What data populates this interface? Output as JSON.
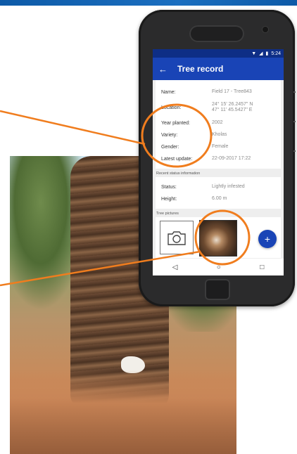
{
  "icons": {
    "back": "arrow-left-icon",
    "camera": "camera-icon",
    "add": "plus-icon",
    "nav_back": "triangle-back-icon",
    "nav_home": "circle-home-icon",
    "nav_recent": "square-recent-icon",
    "wifi": "wifi-icon",
    "signal": "signal-icon",
    "battery": "battery-icon"
  },
  "status_bar": {
    "time": "5:24"
  },
  "app_bar": {
    "title": "Tree record"
  },
  "record": {
    "name_label": "Name:",
    "name_value": "Field 17 - Tree843",
    "location_label": "Location:",
    "location_lat": "24° 15' 26.2457\" N",
    "location_lon": "47° 11' 45.5427\" E",
    "year_label": "Year planted:",
    "year_value": "2002",
    "variety_label": "Variety:",
    "variety_value": "Kholas",
    "gender_label": "Gender:",
    "gender_value": "Female",
    "update_label": "Latest update:",
    "update_value": "22-09-2017 17:22"
  },
  "status_section": {
    "heading": "Recent status information",
    "status_label": "Status:",
    "status_value": "Lightly infested",
    "height_label": "Height:",
    "height_value": "6.00 m"
  },
  "pictures_section": {
    "heading": "Tree pictures"
  },
  "colors": {
    "app_bar": "#1944b6",
    "status_bar": "#0e2e86",
    "annotation": "#f07d1e",
    "banner": "#0d5aa7"
  }
}
